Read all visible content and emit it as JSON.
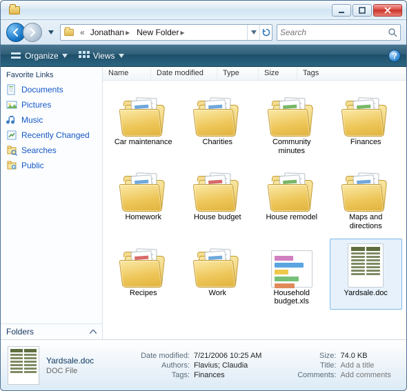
{
  "breadcrumb": {
    "root_glyph": "«",
    "seg1": "Jonathan",
    "seg2": "New Folder"
  },
  "search": {
    "placeholder": "Search"
  },
  "toolbar": {
    "organize": "Organize",
    "views": "Views"
  },
  "sidebar": {
    "header": "Favorite Links",
    "items": [
      {
        "label": "Documents"
      },
      {
        "label": "Pictures"
      },
      {
        "label": "Music"
      },
      {
        "label": "Recently Changed"
      },
      {
        "label": "Searches"
      },
      {
        "label": "Public"
      }
    ],
    "footer": "Folders"
  },
  "columns": {
    "c0": "Name",
    "c1": "Date modified",
    "c2": "Type",
    "c3": "Size",
    "c4": "Tags"
  },
  "items": [
    {
      "label": "Car maintenance",
      "kind": "folder",
      "accent": "blue"
    },
    {
      "label": "Charities",
      "kind": "folder",
      "accent": "blue"
    },
    {
      "label": "Community minutes",
      "kind": "folder",
      "accent": "green"
    },
    {
      "label": "Finances",
      "kind": "folder",
      "accent": "green"
    },
    {
      "label": "Homework",
      "kind": "folder",
      "accent": "blue"
    },
    {
      "label": "House budget",
      "kind": "folder",
      "accent": "red"
    },
    {
      "label": "House remodel",
      "kind": "folder",
      "accent": "green"
    },
    {
      "label": "Maps and directions",
      "kind": "folder",
      "accent": "blue"
    },
    {
      "label": "Recipes",
      "kind": "folder",
      "accent": "red"
    },
    {
      "label": "Work",
      "kind": "folder",
      "accent": "blue"
    },
    {
      "label": "Household budget.xls",
      "kind": "xls"
    },
    {
      "label": "Yardsale.doc",
      "kind": "doc",
      "selected": true
    }
  ],
  "details": {
    "filename": "Yardsale.doc",
    "filetype": "DOC File",
    "k_modified": "Date modified:",
    "v_modified": "7/21/2006 10:25 AM",
    "k_authors": "Authors:",
    "v_authors": "Flavius; Claudia",
    "k_tags": "Tags:",
    "v_tags": "Finances",
    "k_size": "Size:",
    "v_size": "74.0 KB",
    "k_title": "Title:",
    "v_title": "Add a title",
    "k_comments": "Comments:",
    "v_comments": "Add comments"
  }
}
